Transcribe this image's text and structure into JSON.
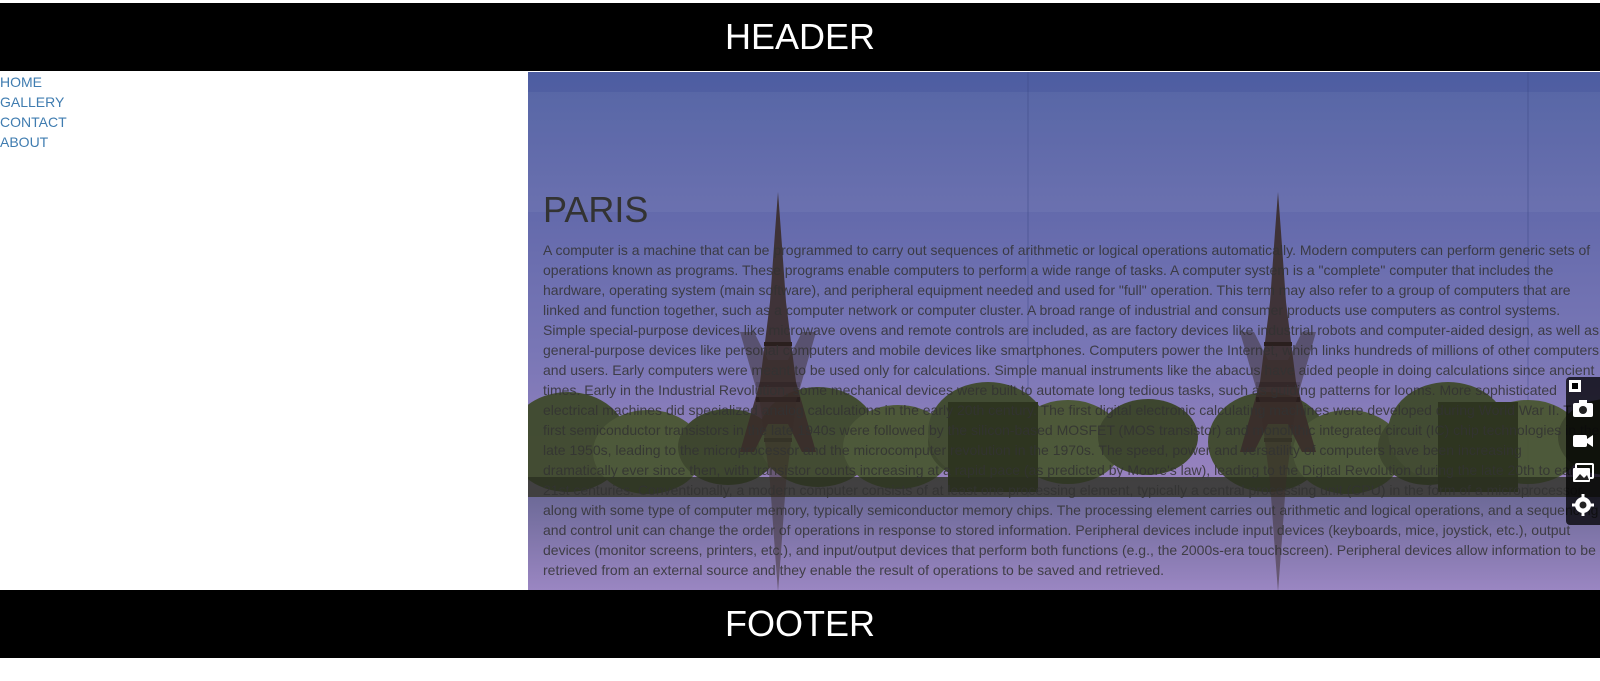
{
  "header": {
    "title": "HEADER"
  },
  "nav": {
    "items": [
      {
        "label": "HOME"
      },
      {
        "label": "GALLERY"
      },
      {
        "label": "CONTACT"
      },
      {
        "label": "ABOUT"
      }
    ]
  },
  "main": {
    "heading": "PARIS",
    "body": "A computer is a machine that can be programmed to carry out sequences of arithmetic or logical operations automatically. Modern computers can perform generic sets of operations known as programs. These programs enable computers to perform a wide range of tasks. A computer system is a \"complete\" computer that includes the hardware, operating system (main software), and peripheral equipment needed and used for \"full\" operation. This term may also refer to a group of computers that are linked and function together, such as a computer network or computer cluster. A broad range of industrial and consumer products use computers as control systems. Simple special-purpose devices like microwave ovens and remote controls are included, as are factory devices like industrial robots and computer-aided design, as well as general-purpose devices like personal computers and mobile devices like smartphones. Computers power the Internet, which links hundreds of millions of other computers and users. Early computers were meant to be used only for calculations. Simple manual instruments like the abacus have aided people in doing calculations since ancient times. Early in the Industrial Revolution, some mechanical devices were built to automate long tedious tasks, such as guiding patterns for looms. More sophisticated electrical machines did specialized analog calculations in the early 20th century. The first digital electronic calculating machines were developed during World War II. The first semiconductor transistors in the late 1940s were followed by the silicon-based MOSFET (MOS transistor) and monolithic integrated circuit (IC) chip technologies in the late 1950s, leading to the microprocessor and the microcomputer revolution in the 1970s. The speed, power and versatility of computers have been increasing dramatically ever since then, with transistor counts increasing at a rapid pace (as predicted by Moore's law), leading to the Digital Revolution during the late 20th to early 21st centuries. Conventionally, a modern computer consists of at least one processing element, typically a central processing unit (CPU) in the form of a microprocessor, along with some type of computer memory, typically semiconductor memory chips. The processing element carries out arithmetic and logical operations, and a sequencing and control unit can change the order of operations in response to stored information. Peripheral devices include input devices (keyboards, mice, joystick, etc.), output devices (monitor screens, printers, etc.), and input/output devices that perform both functions (e.g., the 2000s-era touchscreen). Peripheral devices allow information to be retrieved from an external source and they enable the result of operations to be saved and retrieved."
  },
  "footer": {
    "title": "FOOTER"
  },
  "toolbar": {
    "icons": [
      "pin-icon",
      "camera-icon",
      "video-icon",
      "gallery-icon",
      "gear-icon"
    ]
  },
  "colors": {
    "bar": "#000000",
    "nav_link": "#3f7cb0",
    "sky_top": "#4f5fa3",
    "sky_bottom": "#9a83c0"
  }
}
